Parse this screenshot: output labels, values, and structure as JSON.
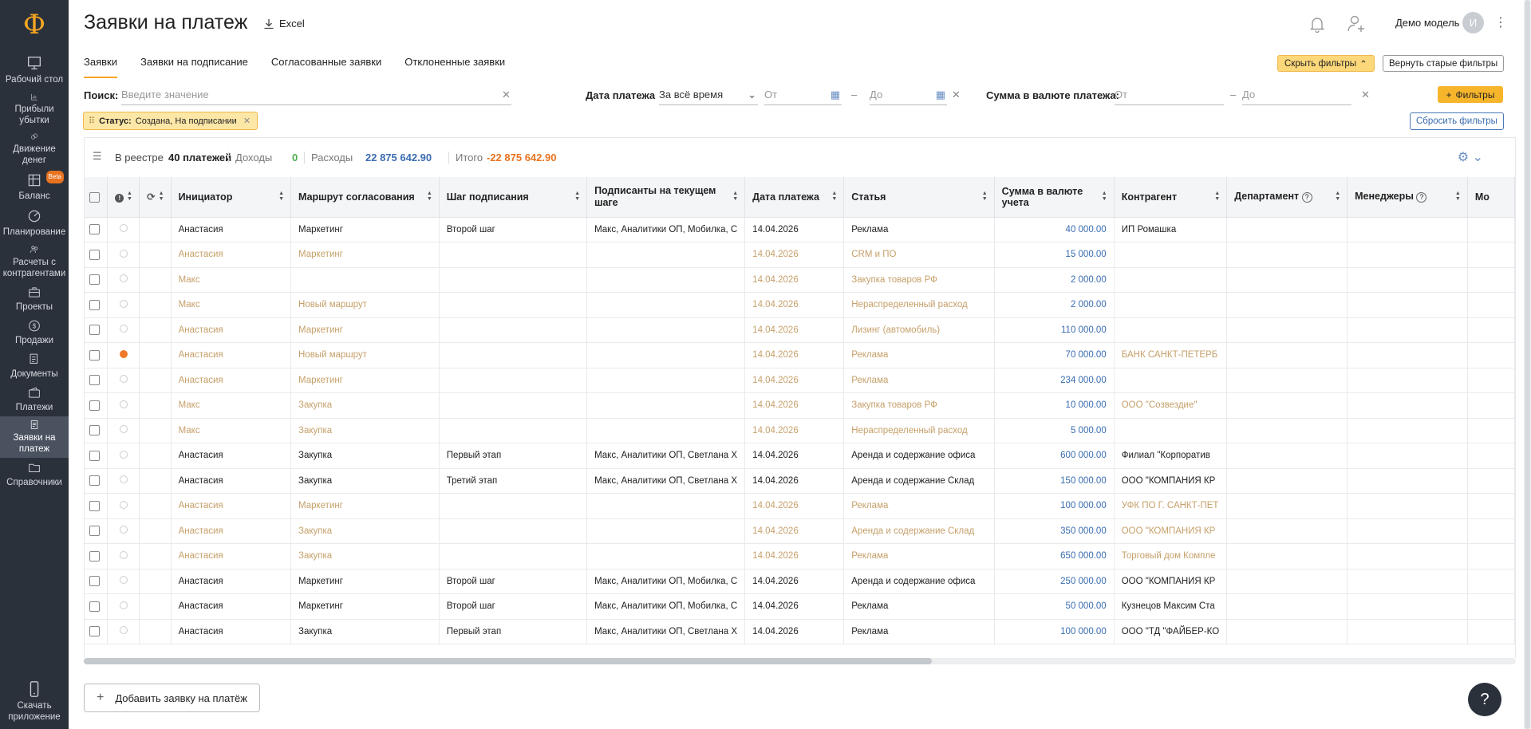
{
  "sidebar": {
    "logo": "Ф",
    "items": [
      {
        "label": "Рабочий стол",
        "icon": "desktop-icon"
      },
      {
        "label": "Прибыли убытки",
        "icon": "chart-icon"
      },
      {
        "label": "Движение денег",
        "icon": "coins-icon"
      },
      {
        "label": "Баланс",
        "icon": "balance-icon",
        "badge": "Beta"
      },
      {
        "label": "Планирование",
        "icon": "planning-icon"
      },
      {
        "label": "Расчеты с контрагентами",
        "icon": "contractors-icon"
      },
      {
        "label": "Проекты",
        "icon": "briefcase-icon"
      },
      {
        "label": "Продажи",
        "icon": "dollar-icon"
      },
      {
        "label": "Документы",
        "icon": "documents-icon"
      },
      {
        "label": "Платежи",
        "icon": "wallet-icon"
      },
      {
        "label": "Заявки на платеж",
        "icon": "request-icon",
        "active": true
      },
      {
        "label": "Справочники",
        "icon": "folder-icon"
      }
    ],
    "download_label": "Скачать приложение"
  },
  "header": {
    "title": "Заявки на платеж",
    "excel_label": "Excel",
    "user_name": "Демо модель",
    "avatar_initial": "И"
  },
  "tabs": [
    "Заявки",
    "Заявки на подписание",
    "Согласованные заявки",
    "Отклоненные заявки"
  ],
  "buttons": {
    "hide_filters": "Скрыть фильтры",
    "old_filters": "Вернуть старые фильтры",
    "filters": "Фильтры",
    "reset_filters": "Сбросить фильтры",
    "add_request": "Добавить заявку на платёж"
  },
  "filters": {
    "search_label": "Поиск:",
    "search_placeholder": "Введите значение",
    "date_label": "Дата платежа",
    "date_select": "За всё время",
    "date_from": "От",
    "date_to": "До",
    "sum_label": "Сумма в валюте платежа:",
    "sum_from": "От",
    "sum_to": "До",
    "chip_label": "Статус:",
    "chip_value": "Создана, На подписании"
  },
  "summary": {
    "registry_label": "В реестре",
    "registry_value": "40 платежей",
    "income_label": "Доходы",
    "income_value": "0",
    "expense_label": "Расходы",
    "expense_value": "22 875 642.90",
    "total_label": "Итого",
    "total_value": "-22 875 642.90"
  },
  "table": {
    "columns": [
      "Инициатор",
      "Маршрут согласования",
      "Шаг подписания",
      "Подписанты на текущем шаге",
      "Дата платежа",
      "Статья",
      "Сумма в валюте учета",
      "Контрагент",
      "Департамент",
      "Менеджеры",
      "Мо"
    ],
    "rows": [
      {
        "draft": false,
        "dot": false,
        "initiator": "Анастасия",
        "route": "Маркетинг",
        "step": "Второй шаг",
        "signers": "Макс, Аналитики ОП, Мобилка, С",
        "date": "14.04.2026",
        "article": "Реклама",
        "sum": "40 000.00",
        "contractor": "ИП Ромашка"
      },
      {
        "draft": true,
        "dot": false,
        "initiator": "Анастасия",
        "route": "Маркетинг",
        "step": "",
        "signers": "",
        "date": "14.04.2026",
        "article": "CRM и ПО",
        "sum": "15 000.00",
        "contractor": ""
      },
      {
        "draft": true,
        "dot": false,
        "initiator": "Макс",
        "route": "",
        "step": "",
        "signers": "",
        "date": "14.04.2026",
        "article": "Закупка товаров РФ",
        "sum": "2 000.00",
        "contractor": ""
      },
      {
        "draft": true,
        "dot": false,
        "initiator": "Макс",
        "route": "Новый маршрут",
        "step": "",
        "signers": "",
        "date": "14.04.2026",
        "article": "Нераспределенный расход",
        "sum": "2 000.00",
        "contractor": ""
      },
      {
        "draft": true,
        "dot": false,
        "initiator": "Анастасия",
        "route": "Маркетинг",
        "step": "",
        "signers": "",
        "date": "14.04.2026",
        "article": "Лизинг (автомобиль)",
        "sum": "110 000.00",
        "contractor": ""
      },
      {
        "draft": true,
        "dot": true,
        "initiator": "Анастасия",
        "route": "Новый маршрут",
        "step": "",
        "signers": "",
        "date": "14.04.2026",
        "article": "Реклама",
        "sum": "70 000.00",
        "contractor": "БАНК САНКТ-ПЕТЕРБ"
      },
      {
        "draft": true,
        "dot": false,
        "initiator": "Анастасия",
        "route": "Маркетинг",
        "step": "",
        "signers": "",
        "date": "14.04.2026",
        "article": "Реклама",
        "sum": "234 000.00",
        "contractor": ""
      },
      {
        "draft": true,
        "dot": false,
        "initiator": "Макс",
        "route": "Закупка",
        "step": "",
        "signers": "",
        "date": "14.04.2026",
        "article": "Закупка товаров РФ",
        "sum": "10 000.00",
        "contractor": "ООО \"Созвездие\""
      },
      {
        "draft": true,
        "dot": false,
        "initiator": "Макс",
        "route": "Закупка",
        "step": "",
        "signers": "",
        "date": "14.04.2026",
        "article": "Нераспределенный расход",
        "sum": "5 000.00",
        "contractor": ""
      },
      {
        "draft": false,
        "dot": false,
        "initiator": "Анастасия",
        "route": "Закупка",
        "step": "Первый этап",
        "signers": "Макс, Аналитики ОП, Светлана Х",
        "date": "14.04.2026",
        "article": "Аренда и содержание офиса",
        "sum": "600 000.00",
        "contractor": "Филиал \"Корпоратив"
      },
      {
        "draft": false,
        "dot": false,
        "initiator": "Анастасия",
        "route": "Закупка",
        "step": "Третий этап",
        "signers": "Макс, Аналитики ОП, Светлана Х",
        "date": "14.04.2026",
        "article": "Аренда и содержание Склад",
        "sum": "150 000.00",
        "contractor": "ООО \"КОМПАНИЯ КР"
      },
      {
        "draft": true,
        "dot": false,
        "initiator": "Анастасия",
        "route": "Маркетинг",
        "step": "",
        "signers": "",
        "date": "14.04.2026",
        "article": "Реклама",
        "sum": "100 000.00",
        "contractor": "УФК ПО Г. САНКТ-ПЕТ"
      },
      {
        "draft": true,
        "dot": false,
        "initiator": "Анастасия",
        "route": "Закупка",
        "step": "",
        "signers": "",
        "date": "14.04.2026",
        "article": "Аренда и содержание Склад",
        "sum": "350 000.00",
        "contractor": "ООО \"КОМПАНИЯ КР"
      },
      {
        "draft": true,
        "dot": false,
        "initiator": "Анастасия",
        "route": "Закупка",
        "step": "",
        "signers": "",
        "date": "14.04.2026",
        "article": "Реклама",
        "sum": "650 000.00",
        "contractor": "Торговый дом Компле"
      },
      {
        "draft": false,
        "dot": false,
        "initiator": "Анастасия",
        "route": "Маркетинг",
        "step": "Второй шаг",
        "signers": "Макс, Аналитики ОП, Мобилка, С",
        "date": "14.04.2026",
        "article": "Аренда и содержание офиса",
        "sum": "250 000.00",
        "contractor": "ООО \"КОМПАНИЯ КР"
      },
      {
        "draft": false,
        "dot": false,
        "initiator": "Анастасия",
        "route": "Маркетинг",
        "step": "Второй шаг",
        "signers": "Макс, Аналитики ОП, Мобилка, С",
        "date": "14.04.2026",
        "article": "Реклама",
        "sum": "50 000.00",
        "contractor": "Кузнецов Максим Ста"
      },
      {
        "draft": false,
        "dot": false,
        "initiator": "Анастасия",
        "route": "Закупка",
        "step": "Первый этап",
        "signers": "Макс, Аналитики ОП, Светлана Х",
        "date": "14.04.2026",
        "article": "Реклама",
        "sum": "100 000.00",
        "contractor": "ООО \"ТД \"ФАЙБЕР-КО"
      }
    ]
  },
  "colors": {
    "accent": "#f5a623",
    "sidebar": "#2b313b",
    "link": "#3a6cb0",
    "income": "#4caf50",
    "total": "#e8731f",
    "draft": "#c6a06a"
  }
}
